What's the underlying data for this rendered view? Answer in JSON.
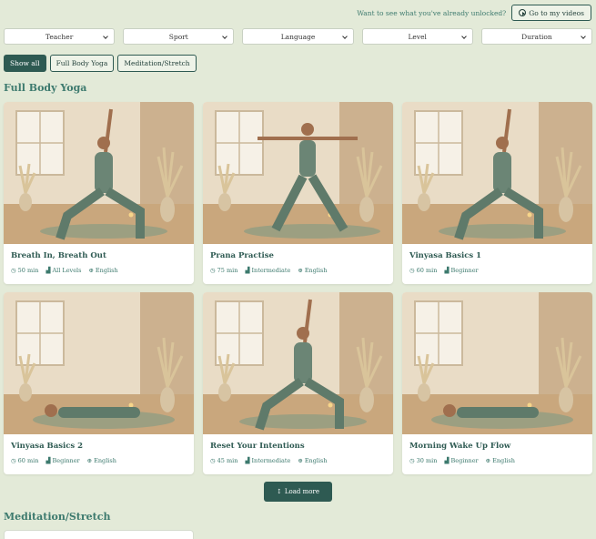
{
  "header": {
    "hint_text": "Want to see what you've already unlocked?",
    "videos_button": "Go to my videos"
  },
  "filters": [
    "Teacher",
    "Sport",
    "Language",
    "Level",
    "Duration"
  ],
  "category_pills": [
    {
      "label": "Show all",
      "active": true
    },
    {
      "label": "Full Body Yoga",
      "active": false
    },
    {
      "label": "Meditation/Stretch",
      "active": false
    }
  ],
  "sections": [
    {
      "title": "Full Body Yoga"
    },
    {
      "title": "Meditation/Stretch"
    }
  ],
  "videos": [
    {
      "title": "Breath In, Breath Out",
      "duration": "50 min",
      "level": "All Levels",
      "language": "English",
      "pose": "lunge-arms-up"
    },
    {
      "title": "Prana Practise",
      "duration": "75 min",
      "level": "Intermediate",
      "language": "English",
      "pose": "warrior-two"
    },
    {
      "title": "Vinyasa Basics 1",
      "duration": "60 min",
      "level": "Beginner",
      "language": "",
      "pose": "lunge-arms-up"
    },
    {
      "title": "Vinyasa Basics 2",
      "duration": "60 min",
      "level": "Beginner",
      "language": "English",
      "pose": "lying"
    },
    {
      "title": "Reset Your Intentions",
      "duration": "45 min",
      "level": "Intermediate",
      "language": "English",
      "pose": "lunge-arms-up"
    },
    {
      "title": "Morning Wake Up Flow",
      "duration": "30 min",
      "level": "Beginner",
      "language": "English",
      "pose": "lying"
    }
  ],
  "load_more": "Load more",
  "icons": {
    "clock": "clock-icon",
    "level": "bar-chart-icon",
    "language": "globe-icon",
    "play": "play-circle-icon",
    "load": "arrows-vertical-icon"
  },
  "colors": {
    "background": "#e3ead8",
    "accent": "#2e5a52",
    "text_accent": "#3d7a6e"
  }
}
